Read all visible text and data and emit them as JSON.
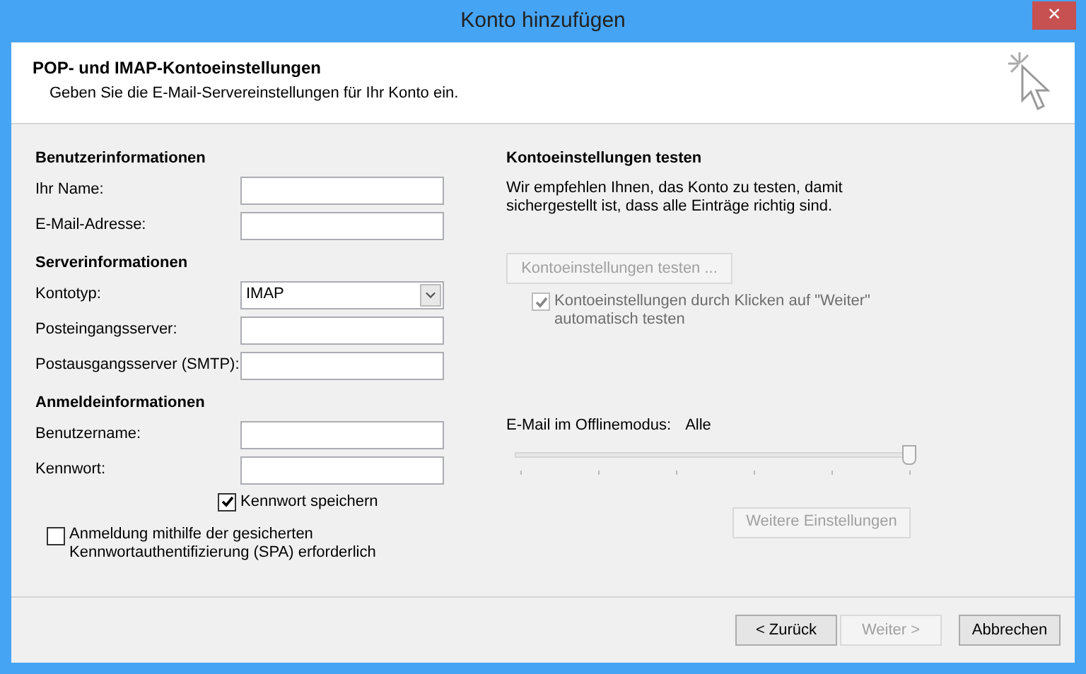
{
  "window": {
    "title": "Konto hinzufügen",
    "close": "×"
  },
  "header": {
    "title": "POP- und IMAP-Kontoeinstellungen",
    "subtitle": "Geben Sie die E-Mail-Servereinstellungen für Ihr Konto ein."
  },
  "sections": [
    {
      "title": "Benutzerinformationen",
      "fields": [
        {
          "label": "Ihr Name:",
          "kind": "text"
        },
        {
          "label": "E-Mail-Adresse:",
          "kind": "text"
        }
      ]
    },
    {
      "title": "Serverinformationen",
      "fields": [
        {
          "label": "Kontotyp:",
          "kind": "select",
          "value": "IMAP"
        },
        {
          "label": "Posteingangsserver:",
          "kind": "text"
        },
        {
          "label": "Postausgangsserver (SMTP):",
          "kind": "text"
        }
      ]
    },
    {
      "title": "Anmeldeinformationen",
      "fields": [
        {
          "label": "Benutzername:",
          "kind": "text"
        },
        {
          "label": "Kennwort:",
          "kind": "text"
        }
      ]
    }
  ],
  "save_password": {
    "label": "Kennwort speichern",
    "checked": true
  },
  "spa": {
    "label": "Anmeldung mithilfe der gesicherten Kennwortauthentifizierung (SPA) erforderlich",
    "checked": false
  },
  "test": {
    "title": "Kontoeinstellungen testen",
    "description": "Wir empfehlen Ihnen, das Konto zu testen, damit sichergestellt ist, dass alle Einträge richtig sind.",
    "button": {
      "label": "Kontoeinstellungen testen ...",
      "disabled": true
    },
    "auto": {
      "label": "Kontoeinstellungen durch Klicken auf \"Weiter\" automatisch testen",
      "checked": true,
      "disabled": true
    }
  },
  "offline": {
    "label": "E-Mail im Offlinemodus:",
    "value": "Alle",
    "level": 1
  },
  "more_button": {
    "label": "Weitere Einstellungen",
    "disabled": true
  },
  "footer_buttons": [
    {
      "label": "< Zurück",
      "disabled": false
    },
    {
      "label": "Weiter >",
      "disabled": true
    },
    {
      "label": "Abbrechen",
      "disabled": false
    }
  ]
}
